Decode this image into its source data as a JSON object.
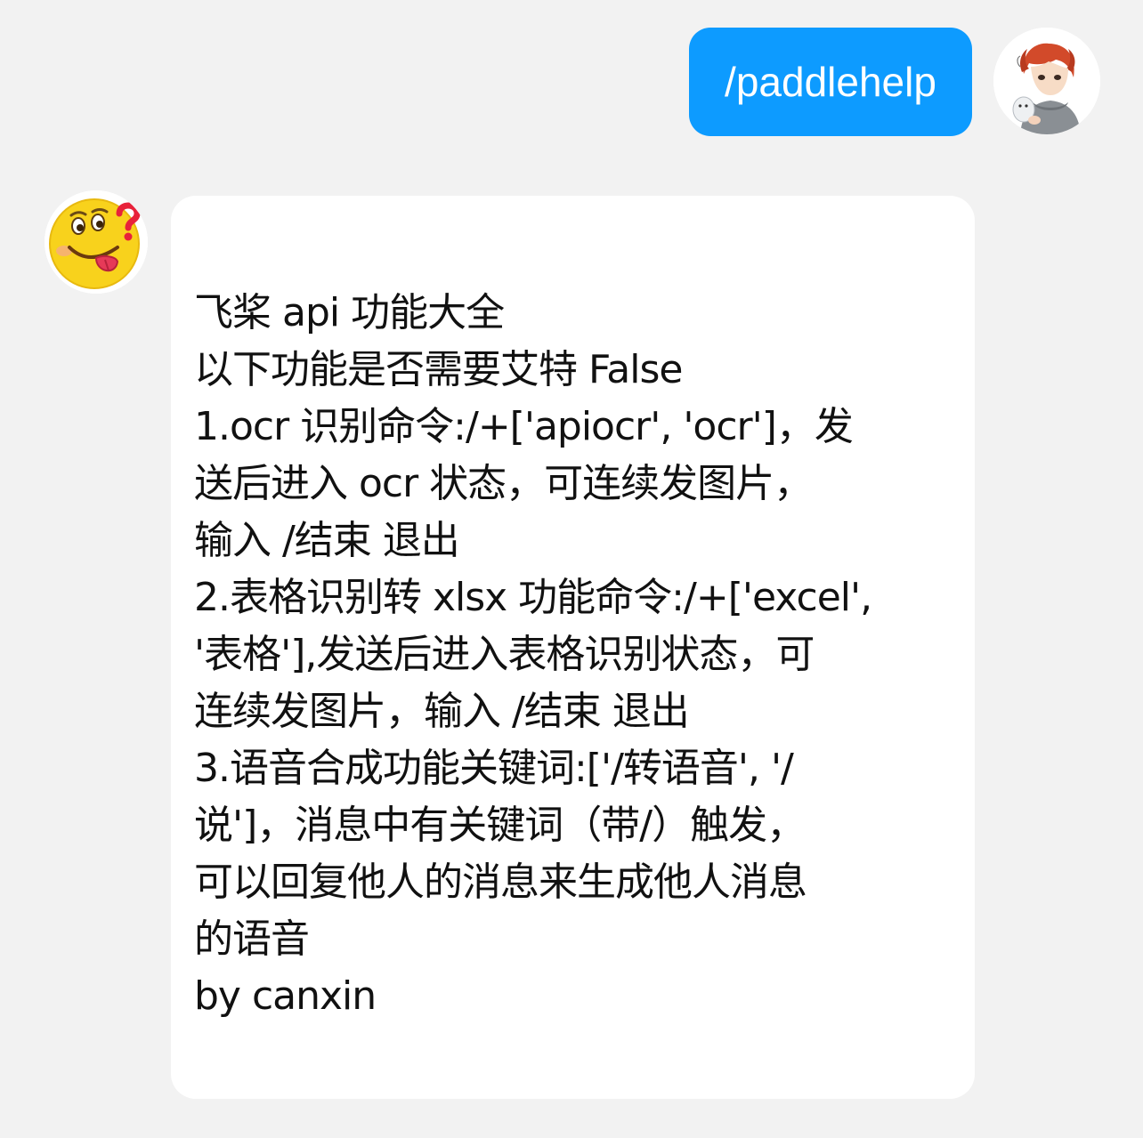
{
  "conversation": {
    "outgoing": {
      "text": "/paddlehelp",
      "bubble_color": "#0d9bff",
      "avatar_icon": "anime-character-avatar-icon"
    },
    "incoming": {
      "avatar_icon": "tongue-out-emoji-icon",
      "lines": [
        "飞桨 api 功能大全",
        "以下功能是否需要艾特 False",
        "1.ocr 识别命令:/+['apiocr', 'ocr']，发",
        "送后进入 ocr 状态，可连续发图片，",
        "输入 /结束 退出",
        "2.表格识别转 xlsx 功能命令:/+['excel',",
        "'表格'],发送后进入表格识别状态，可",
        "连续发图片，输入 /结束 退出",
        "3.语音合成功能关键词:['/转语音', '/",
        "说']，消息中有关键词（带/）触发，",
        "可以回复他人的消息来生成他人消息",
        "的语音",
        "by canxin"
      ]
    }
  },
  "colors": {
    "background": "#f2f2f2",
    "incoming_bubble": "#ffffff",
    "outgoing_bubble": "#0d9bff"
  }
}
